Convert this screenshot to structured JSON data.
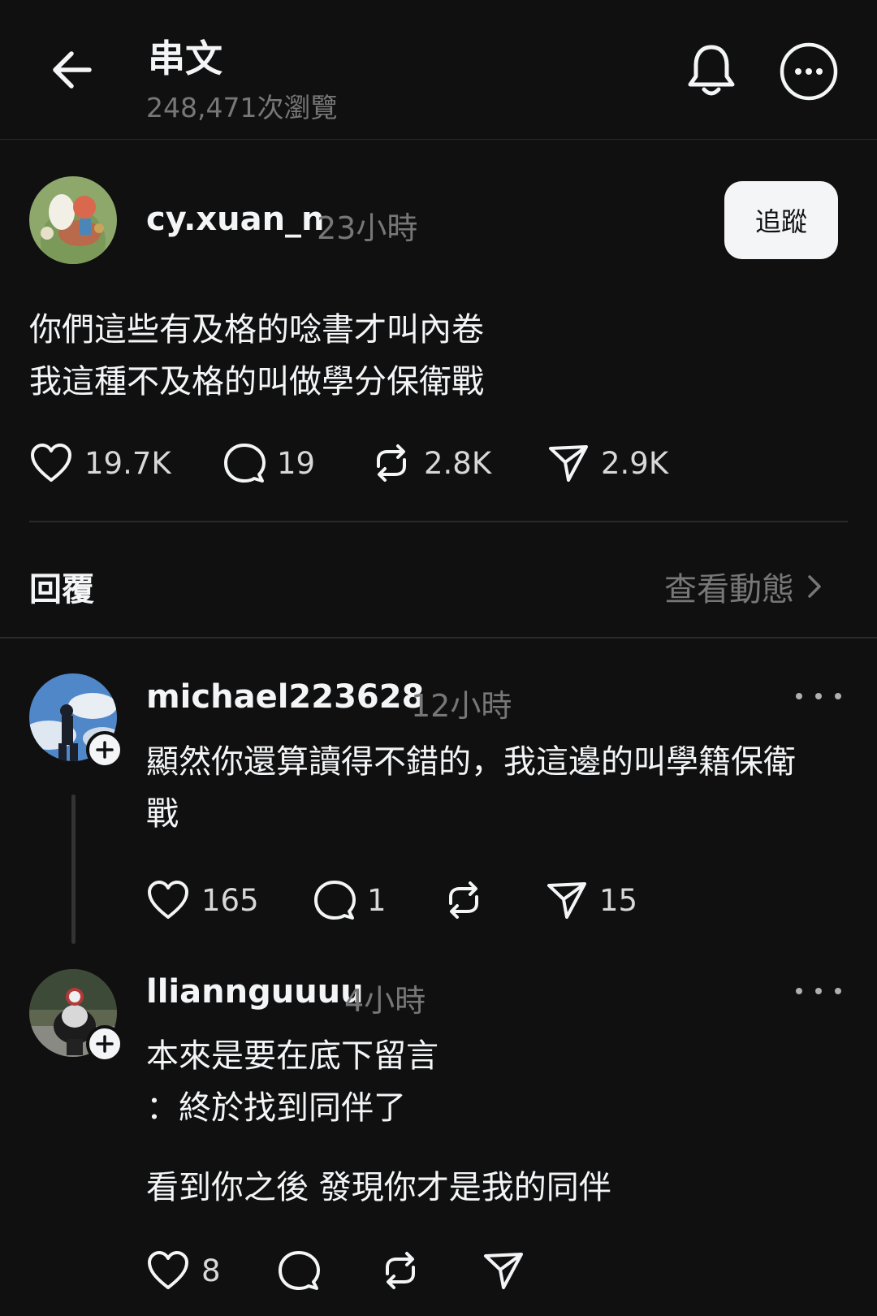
{
  "header": {
    "title": "串文",
    "views": "248,471次瀏覽"
  },
  "post": {
    "username": "cy.xuan_n",
    "time": "23小時",
    "follow_label": "追蹤",
    "lines": [
      "你們這些有及格的唸書才叫內卷",
      "我這種不及格的叫做學分保衛戰"
    ],
    "likes": "19.7K",
    "comments": "19",
    "reposts": "2.8K",
    "shares": "2.9K"
  },
  "replies_section": {
    "label": "回覆",
    "activity_link": "查看動態"
  },
  "replies": [
    {
      "username": "michael223628",
      "time": "12小時",
      "lines": [
        "顯然你還算讀得不錯的，我這邊的叫學籍保衛",
        "戰"
      ],
      "likes": "165",
      "comments": "1",
      "reposts": "",
      "shares": "15"
    },
    {
      "username": "lliannguuuu",
      "time": "4小時",
      "lines": [
        "本來是要在底下留言",
        "：終於找到同伴了",
        "看到你之後 發現你才是我的同伴"
      ],
      "likes": "8",
      "comments": "",
      "reposts": "",
      "shares": ""
    }
  ],
  "icons": {
    "back": "arrow-left-icon",
    "bell": "bell-icon",
    "more": "more-circle-icon",
    "like": "heart-icon",
    "comment": "comment-bubble-icon",
    "repost": "repost-icon",
    "share": "send-icon",
    "chevron": "chevron-right-icon",
    "plus": "plus-icon"
  },
  "colors": {
    "background": "#101010",
    "text": "#f3f5f7",
    "muted": "#777777",
    "divider": "#2a2a2a"
  }
}
